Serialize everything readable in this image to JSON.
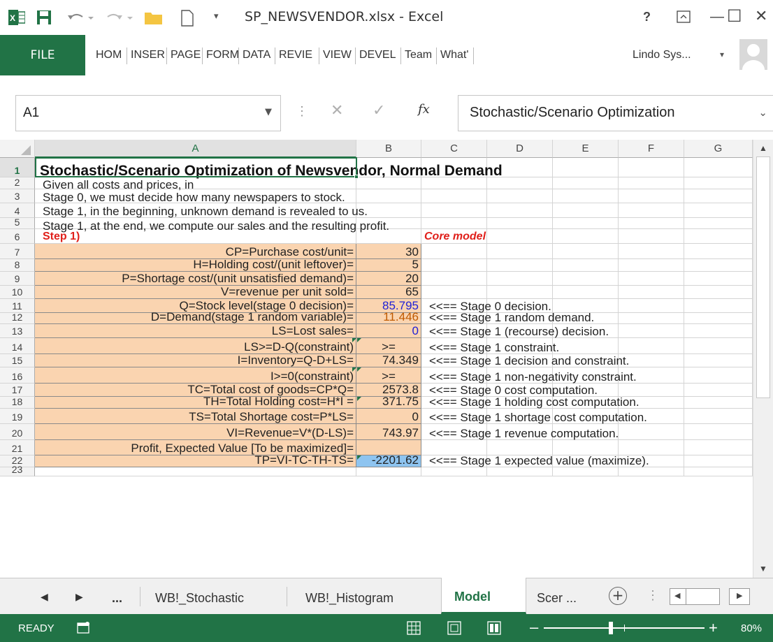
{
  "window": {
    "title": "SP_NEWSVENDOR.xlsx - Excel",
    "help": "?",
    "min": "—",
    "max": "☐",
    "close": "✕"
  },
  "ribbon": {
    "file": "FILE",
    "tabs": [
      "HOM",
      "INSER",
      "PAGE",
      "FORM",
      "DATA",
      "REVIE",
      "VIEW",
      "DEVEL",
      "Team",
      "What'"
    ],
    "account": "Lindo Sys..."
  },
  "formula_bar": {
    "name_box": "A1",
    "fx": "fx",
    "formula": "Stochastic/Scenario Optimization"
  },
  "columns": [
    "A",
    "B",
    "C",
    "D",
    "E",
    "F",
    "G"
  ],
  "rows": [
    "1",
    "2",
    "3",
    "4",
    "5",
    "6",
    "7",
    "8",
    "9",
    "10",
    "11",
    "12",
    "13",
    "14",
    "15",
    "16",
    "17",
    "18",
    "19",
    "20",
    "21",
    "22",
    "23"
  ],
  "sheet": {
    "r1": "Stochastic/Scenario Optimization of Newsvendor, Normal Demand",
    "r2": "Given all costs and prices, in",
    "r3": "Stage 0, we must decide how many newspapers to stock.",
    "r4": "Stage 1, in the beginning, unknown demand is revealed to us.",
    "r5": "Stage 1, at the end, we compute our sales and the resulting profit.",
    "r6a": "Step 1)",
    "r6c": "Core model",
    "labels": [
      "CP=Purchase cost/unit=",
      "H=Holding cost/(unit leftover)=",
      "P=Shortage cost/(unit unsatisfied demand)=",
      "V=revenue per unit sold=",
      "Q=Stock level(stage 0 decision)=",
      "D=Demand(stage 1 random variable)=",
      "LS=Lost sales=",
      "LS>=D-Q(constraint)",
      "I=Inventory=Q-D+LS=",
      "I>=0(constraint)",
      "TC=Total cost of goods=CP*Q=",
      "TH=Total Holding cost=H*I =",
      "TS=Total Shortage cost=P*LS=",
      "VI=Revenue=V*(D-LS)=",
      "Profit, Expected Value [To be maximized]=",
      "TP=VI-TC-TH-TS="
    ],
    "values": [
      "30",
      "5",
      "20",
      "65",
      "85.795",
      "11.446",
      "0",
      ">=",
      "74.349",
      ">=",
      "2573.8",
      "371.75",
      "0",
      "743.97",
      "",
      "-2201.62"
    ],
    "notes": [
      "",
      "",
      "",
      "",
      "<<== Stage 0 decision.",
      "<<== Stage 1 random demand.",
      "<<== Stage 1 (recourse) decision.",
      "<<== Stage 1 constraint.",
      "<<== Stage 1 decision and constraint.",
      "<<== Stage 1 non-negativity constraint.",
      "<<== Stage 0 cost computation.",
      "<<== Stage 1 holding cost computation.",
      "<<== Stage 1 shortage cost computation.",
      "<<== Stage 1 revenue computation.",
      "",
      "<<== Stage 1 expected value (maximize)."
    ]
  },
  "tabs": {
    "ellipsis": "...",
    "sheets": [
      "WB!_Stochastic",
      "WB!_Histogram",
      "Model",
      "Scer ..."
    ],
    "add": "+"
  },
  "status": {
    "ready": "READY",
    "zoom": "80%"
  },
  "colors": {
    "excel_green": "#217346",
    "input_orange": "#fad4b0",
    "selected_blue": "#8ec4f0"
  }
}
